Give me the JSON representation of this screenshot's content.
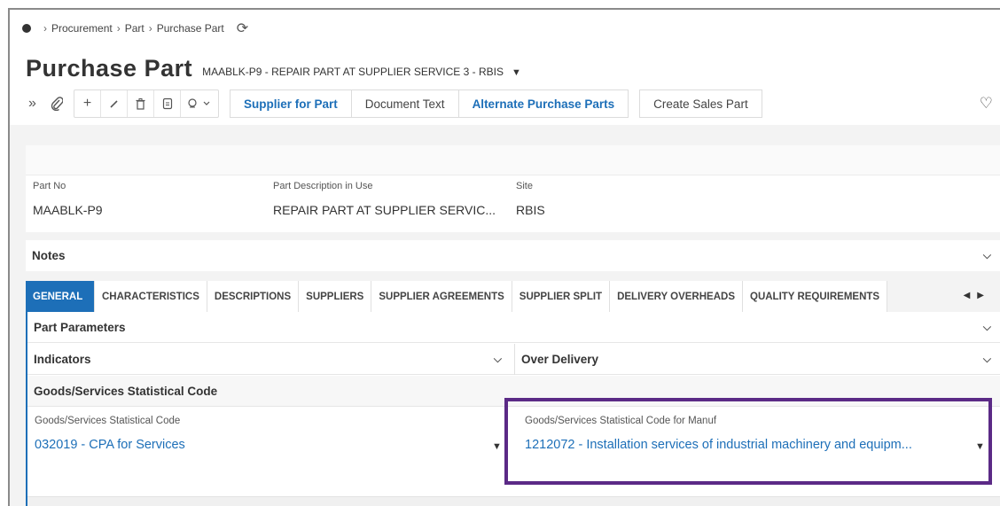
{
  "breadcrumb": [
    "Procurement",
    "Part",
    "Purchase Part"
  ],
  "title": {
    "main": "Purchase Part",
    "subtitle": "MAABLK-P9 - REPAIR PART AT SUPPLIER SERVICE 3 - RBIS"
  },
  "toolbar": {
    "buttons": {
      "supplier_for_part": "Supplier for Part",
      "document_text": "Document Text",
      "alternate_purchase_parts": "Alternate Purchase Parts",
      "create_sales_part": "Create Sales Part"
    }
  },
  "header": {
    "part_no_label": "Part No",
    "part_no_value": "MAABLK-P9",
    "part_desc_label": "Part Description in Use",
    "part_desc_value": "REPAIR PART AT SUPPLIER SERVIC...",
    "site_label": "Site",
    "site_value": "RBIS"
  },
  "notes": {
    "label": "Notes"
  },
  "tabs": [
    "GENERAL",
    "CHARACTERISTICS",
    "DESCRIPTIONS",
    "SUPPLIERS",
    "SUPPLIER AGREEMENTS",
    "SUPPLIER SPLIT",
    "DELIVERY OVERHEADS",
    "QUALITY REQUIREMENTS"
  ],
  "general": {
    "part_parameters": "Part Parameters",
    "indicators": "Indicators",
    "over_delivery": "Over Delivery",
    "goods_services_group": "Goods/Services Statistical Code",
    "stat_code_label": "Goods/Services Statistical Code",
    "stat_code_value": "032019 - CPA for Services",
    "stat_code_manuf_label": "Goods/Services Statistical Code for Manuf",
    "stat_code_manuf_value": "1212072 - Installation services of industrial machinery and equipm..."
  },
  "colors": {
    "accent": "#1d6fb8",
    "highlight_border": "#5b2a86"
  }
}
